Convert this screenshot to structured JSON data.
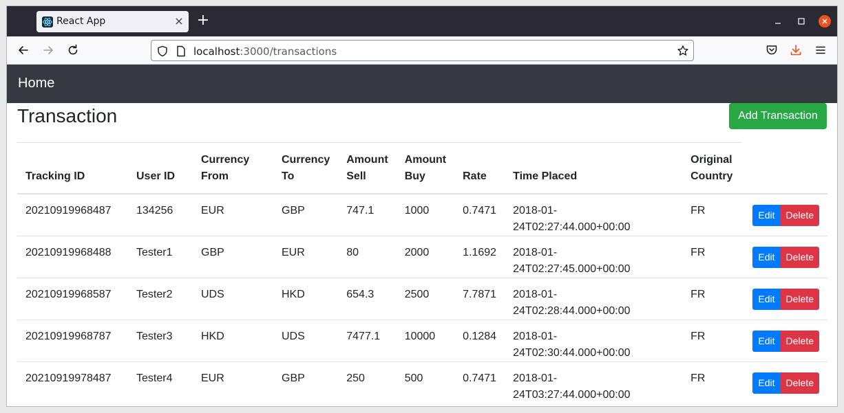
{
  "browser": {
    "tab_title": "React App",
    "tab_close_glyph": "×",
    "new_tab_glyph": "+",
    "url_host": "localhost",
    "url_rest": ":3000/transactions",
    "icons": [
      "react-favicon-icon",
      "back-arrow-icon",
      "forward-arrow-icon",
      "reload-icon",
      "shield-icon",
      "page-icon",
      "bookmark-star-icon",
      "pocket-icon",
      "download-icon",
      "menu-icon",
      "minimize-icon",
      "maximize-icon",
      "close-window-icon"
    ],
    "accent_download": "#e95420"
  },
  "app": {
    "nav_home": "Home",
    "nav_bg": "#343a40"
  },
  "page": {
    "title": "Transaction",
    "add_button": "Add Transaction",
    "add_button_color": "#28a745"
  },
  "table": {
    "headers": [
      [
        "Tracking ID"
      ],
      [
        "User ID"
      ],
      [
        "Currency",
        "From"
      ],
      [
        "Currency",
        "To"
      ],
      [
        "Amount",
        "Sell"
      ],
      [
        "Amount",
        "Buy"
      ],
      [
        "Rate"
      ],
      [
        "Time Placed"
      ],
      [
        "Original",
        "Country"
      ]
    ],
    "edit_label": "Edit",
    "delete_label": "Delete",
    "edit_color": "#007bff",
    "delete_color": "#dc3545",
    "rows": [
      [
        "20210919968487",
        "134256",
        "EUR",
        "GBP",
        "747.1",
        "1000",
        "0.7471",
        "2018-01-24T02:27:44.000+00:00",
        "FR"
      ],
      [
        "20210919968488",
        "Tester1",
        "GBP",
        "EUR",
        "80",
        "2000",
        "1.1692",
        "2018-01-24T02:27:45.000+00:00",
        "FR"
      ],
      [
        "20210919968587",
        "Tester2",
        "UDS",
        "HKD",
        "654.3",
        "2500",
        "7.7871",
        "2018-01-24T02:28:44.000+00:00",
        "FR"
      ],
      [
        "20210919968787",
        "Tester3",
        "HKD",
        "UDS",
        "7477.1",
        "10000",
        "0.1284",
        "2018-01-24T02:30:44.000+00:00",
        "FR"
      ],
      [
        "20210919978487",
        "Tester4",
        "EUR",
        "GBP",
        "250",
        "500",
        "0.7471",
        "2018-01-24T03:27:44.000+00:00",
        "FR"
      ]
    ]
  }
}
